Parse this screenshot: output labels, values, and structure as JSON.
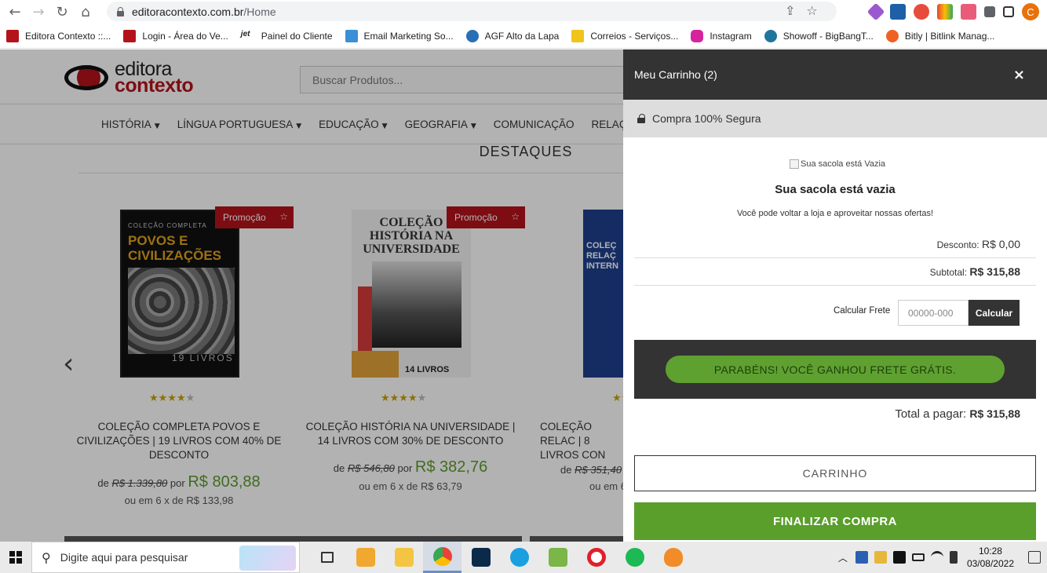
{
  "browser": {
    "url_domain": "editoracontexto.com.br",
    "url_path": "/Home",
    "bookmarks": [
      {
        "label": "Editora Contexto ::...",
        "color": "#b3141c"
      },
      {
        "label": "Login - Área do Ve...",
        "color": "#b3141c"
      },
      {
        "label": "Painel do Cliente",
        "icon_text": "jet",
        "color": "#333"
      },
      {
        "label": "Email Marketing So...",
        "color": "#3b8fd6"
      },
      {
        "label": "AGF Alto da Lapa",
        "color": "#2a6fb5"
      },
      {
        "label": "Correios - Serviços...",
        "color": "#f0c419"
      },
      {
        "label": "Instagram",
        "color": "#d6249f"
      },
      {
        "label": "Showoff - BigBangT...",
        "color": "#21759b"
      },
      {
        "label": "Bitly | Bitlink Manag...",
        "color": "#ee6123"
      }
    ],
    "profile_initial": "C"
  },
  "site": {
    "search_placeholder": "Buscar Produtos...",
    "logo": {
      "line1": "editora",
      "line2": "contexto"
    },
    "menu": [
      {
        "label": "HISTÓRIA",
        "has_dropdown": true
      },
      {
        "label": "LÍNGUA PORTUGUESA",
        "has_dropdown": true
      },
      {
        "label": "EDUCAÇÃO",
        "has_dropdown": true
      },
      {
        "label": "GEOGRAFIA",
        "has_dropdown": true
      },
      {
        "label": "COMUNICAÇÃO",
        "has_dropdown": false
      },
      {
        "label": "RELAÇ",
        "has_dropdown": false
      }
    ],
    "section_title": "DESTAQUES",
    "promo_label": "Promoção",
    "products": [
      {
        "cover_text": "POVOS E CIVILIZAÇÕES",
        "cover_top": "COLEÇÃO COMPLETA",
        "cover_bottom": "19 LIVROS",
        "name": "COLEÇÃO COMPLETA POVOS E CIVILIZAÇÕES | 19 LIVROS COM 40% DE DESCONTO",
        "price_de": "de",
        "price_old": "R$ 1.339,80",
        "price_por": "por",
        "price_new": "R$ 803,88",
        "installments": "ou em 6 x de R$ 133,98",
        "rating": 4
      },
      {
        "cover_text": "COLEÇÃO HISTÓRIA NA UNIVERSIDADE",
        "cover_bottom": "14 LIVROS",
        "name": "COLEÇÃO HISTÓRIA NA UNIVERSIDADE | 14 LIVROS COM 30% DE DESCONTO",
        "price_de": "de",
        "price_old": "R$ 546,80",
        "price_por": "por",
        "price_new": "R$ 382,76",
        "installments": "ou em 6 x de R$ 63,79",
        "rating": 4
      },
      {
        "cover_text": "COLEÇ RELAÇ INTERN",
        "name": "COLEÇÃO RELAC | 8 LIVROS CON",
        "price_de": "de",
        "price_old": "R$ 351,40",
        "installments": "ou em 6",
        "rating": 4
      }
    ]
  },
  "cart": {
    "title": "Meu Carrinho (2)",
    "close_icon": "×",
    "secure_label": "Compra 100% Segura",
    "empty_img_alt": "Sua sacola está Vazia",
    "empty_title": "Sua sacola está vazia",
    "empty_subtitle": "Você pode voltar a loja e aproveitar nossas ofertas!",
    "discount_label": "Desconto:",
    "discount_value": "R$ 0,00",
    "subtotal_label": "Subtotal:",
    "subtotal_value": "R$ 315,88",
    "frete_label": "Calcular Frete",
    "cep_placeholder": "00000-000",
    "calc_button": "Calcular",
    "free_shipping_banner": "PARABÉNS! VOCÊ GANHOU FRETE GRÁTIS.",
    "total_label": "Total a pagar:",
    "total_value": "R$ 315,88",
    "cart_button": "CARRINHO",
    "checkout_button": "FINALIZAR COMPRA",
    "accent_color": "#5a9e2b"
  },
  "taskbar": {
    "search_placeholder": "Digite aqui para pesquisar",
    "time": "10:28",
    "date": "03/08/2022"
  }
}
